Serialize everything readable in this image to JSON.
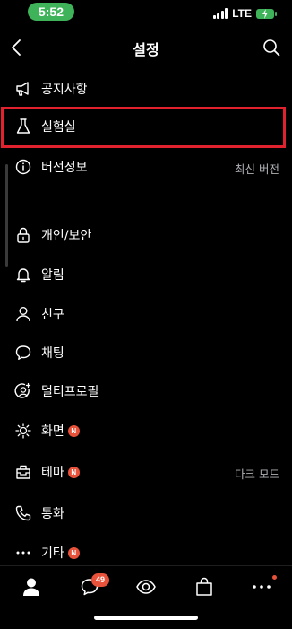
{
  "status": {
    "time": "5:52",
    "network": "LTE"
  },
  "header": {
    "title": "설정"
  },
  "menu": [
    {
      "label": "공지사항",
      "icon": "megaphone-icon"
    },
    {
      "label": "실험실",
      "icon": "flask-icon"
    },
    {
      "label": "버전정보",
      "icon": "info-icon",
      "value": "최신 버전"
    },
    {
      "label": "개인/보안",
      "icon": "lock-icon"
    },
    {
      "label": "알림",
      "icon": "bell-icon"
    },
    {
      "label": "친구",
      "icon": "person-icon"
    },
    {
      "label": "채팅",
      "icon": "chat-bubble-icon"
    },
    {
      "label": "멀티프로필",
      "icon": "multi-profile-icon"
    },
    {
      "label": "화면",
      "icon": "brightness-icon",
      "badge": "N"
    },
    {
      "label": "테마",
      "icon": "theme-icon",
      "badge": "N",
      "value": "다크 모드"
    },
    {
      "label": "통화",
      "icon": "phone-icon"
    },
    {
      "label": "기타",
      "icon": "more-icon",
      "badge": "N"
    }
  ],
  "tabbar": {
    "chat_badge": "49",
    "tabs": [
      "friends-tab",
      "chats-tab",
      "view-tab",
      "shopping-tab",
      "more-tab"
    ]
  },
  "colors": {
    "highlight": "#e0212e",
    "badge": "#e8523a",
    "status_pill": "#3fb35a"
  }
}
